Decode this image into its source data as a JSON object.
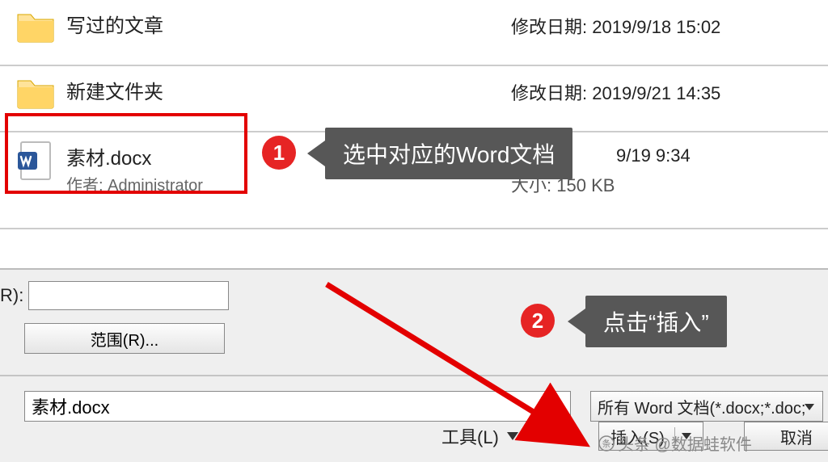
{
  "files": [
    {
      "name": "写过的文章",
      "date_label": "修改日期:",
      "date": "2019/9/18 15:02"
    },
    {
      "name": "新建文件夹",
      "date_label": "修改日期:",
      "date": "2019/9/21 14:35"
    },
    {
      "name": "素材.docx",
      "author_label": "作者:",
      "author": "Administrator",
      "date_partial": "9/19 9:34",
      "size_label": "大小:",
      "size": "150 KB"
    }
  ],
  "annotations": {
    "badge1": "1",
    "callout1": "选中对应的Word文档",
    "badge2": "2",
    "callout2": "点击“插入”"
  },
  "bottom": {
    "r_label": "R):",
    "range_btn": "范围(R)...",
    "filename_value": "素材.docx",
    "filetype_value": "所有 Word 文档(*.docx;*.doc;",
    "tools_label": "工具(L)",
    "insert_btn": "插入(S)",
    "cancel_btn": "取消"
  },
  "watermark": "头条 @数据蛙软件"
}
